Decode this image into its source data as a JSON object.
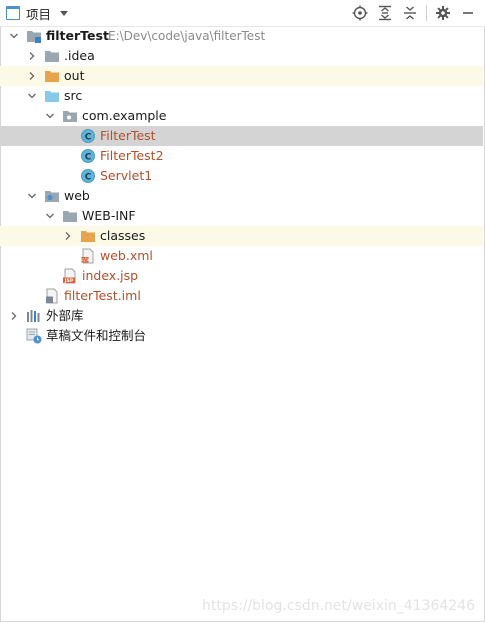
{
  "header": {
    "title": "项目",
    "tools": [
      "locate-icon",
      "expand-all-icon",
      "collapse-all-icon",
      "gear-icon",
      "minimize-icon"
    ]
  },
  "tree": {
    "project": {
      "name": "filterTest",
      "path": "E:\\Dev\\code\\java\\filterTest"
    },
    "idea": ".idea",
    "out": "out",
    "src": "src",
    "package": "com.example",
    "class1": "FilterTest",
    "class2": "FilterTest2",
    "class3": "Servlet1",
    "web": "web",
    "webinf": "WEB-INF",
    "classes": "classes",
    "webxml": "web.xml",
    "indexjsp": "index.jsp",
    "iml": "filterTest.iml",
    "external": "外部库",
    "scratches": "草稿文件和控制台"
  },
  "watermark": "https://blog.csdn.net/weixin_41364246",
  "colors": {
    "selected_row": "#d4d4d4",
    "highlight_row": "#fcfae6",
    "modified_text": "#b44f2a",
    "folder_orange": "#e8a34d",
    "folder_blue": "#88c8e8"
  }
}
